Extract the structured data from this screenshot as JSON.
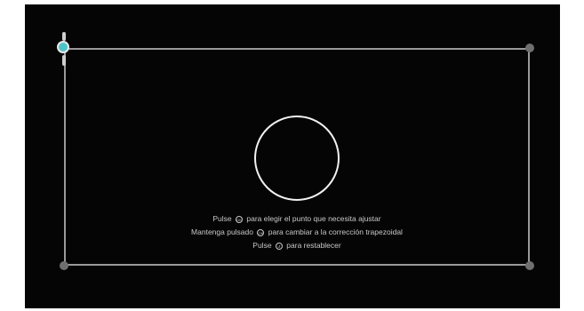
{
  "hints": {
    "line1_pre": "Pulse",
    "line1_post": "para elegir el punto que necesita ajustar",
    "line2_pre": "Mantenga pulsado",
    "line2_post": "para cambiar a la corrección trapezoidal",
    "line3_pre": "Pulse",
    "line3_post": "para restablecer"
  },
  "icons": {
    "ok_button": "ok-button-icon",
    "reset_button": "reset-button-icon"
  },
  "colors": {
    "background": "#050505",
    "frame": "#9a9a9a",
    "active_corner": "#4fc3c8",
    "text": "#c8c8c8"
  }
}
